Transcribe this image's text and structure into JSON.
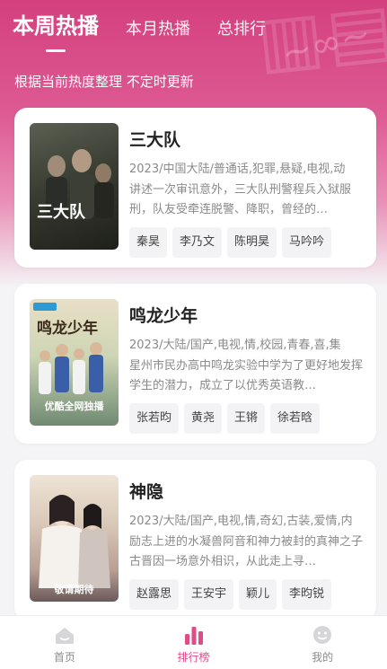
{
  "tabs": [
    {
      "label": "本周热播"
    },
    {
      "label": "本月热播"
    },
    {
      "label": "总排行"
    }
  ],
  "subtitle": "根据当前热度整理 不定时更新",
  "shows": [
    {
      "title": "三大队",
      "meta": "2023/中国大陆/普通话,犯罪,悬疑,电视,动",
      "desc": "讲述一次审讯意外，三大队刑警程兵入狱服刑，队友受牵连脱警、降职，曾经的…",
      "cast": [
        "秦昊",
        "李乃文",
        "陈明昊",
        "马吟吟"
      ],
      "poster_text": "三大队",
      "poster_caption": ""
    },
    {
      "title": "鸣龙少年",
      "meta": "2023/大陆/国产,电视,情,校园,青春,喜,集",
      "desc": "星州市民办高中鸣龙实验中学为了更好地发挥学生的潜力，成立了以优秀英语教…",
      "cast": [
        "张若昀",
        "黄尧",
        "王锵",
        "徐若晗"
      ],
      "poster_text": "鸣龙少年",
      "poster_caption": "优酷全网独播"
    },
    {
      "title": "神隐",
      "meta": "2023/大陆/国产,电视,情,奇幻,古装,爱情,内",
      "desc": "励志上进的水凝兽阿音和神力被封的真神之子古晋因一场意外相识，从此走上寻…",
      "cast": [
        "赵露思",
        "王安宇",
        "颖儿",
        "李昀锐"
      ],
      "poster_text": "",
      "poster_caption": "敬请期待"
    }
  ],
  "nav": [
    {
      "label": "首页",
      "icon": "home-icon"
    },
    {
      "label": "排行榜",
      "icon": "chart-icon"
    },
    {
      "label": "我的",
      "icon": "profile-icon"
    }
  ],
  "colors": {
    "accent": "#e04c8a",
    "hero": "#d4407e"
  }
}
